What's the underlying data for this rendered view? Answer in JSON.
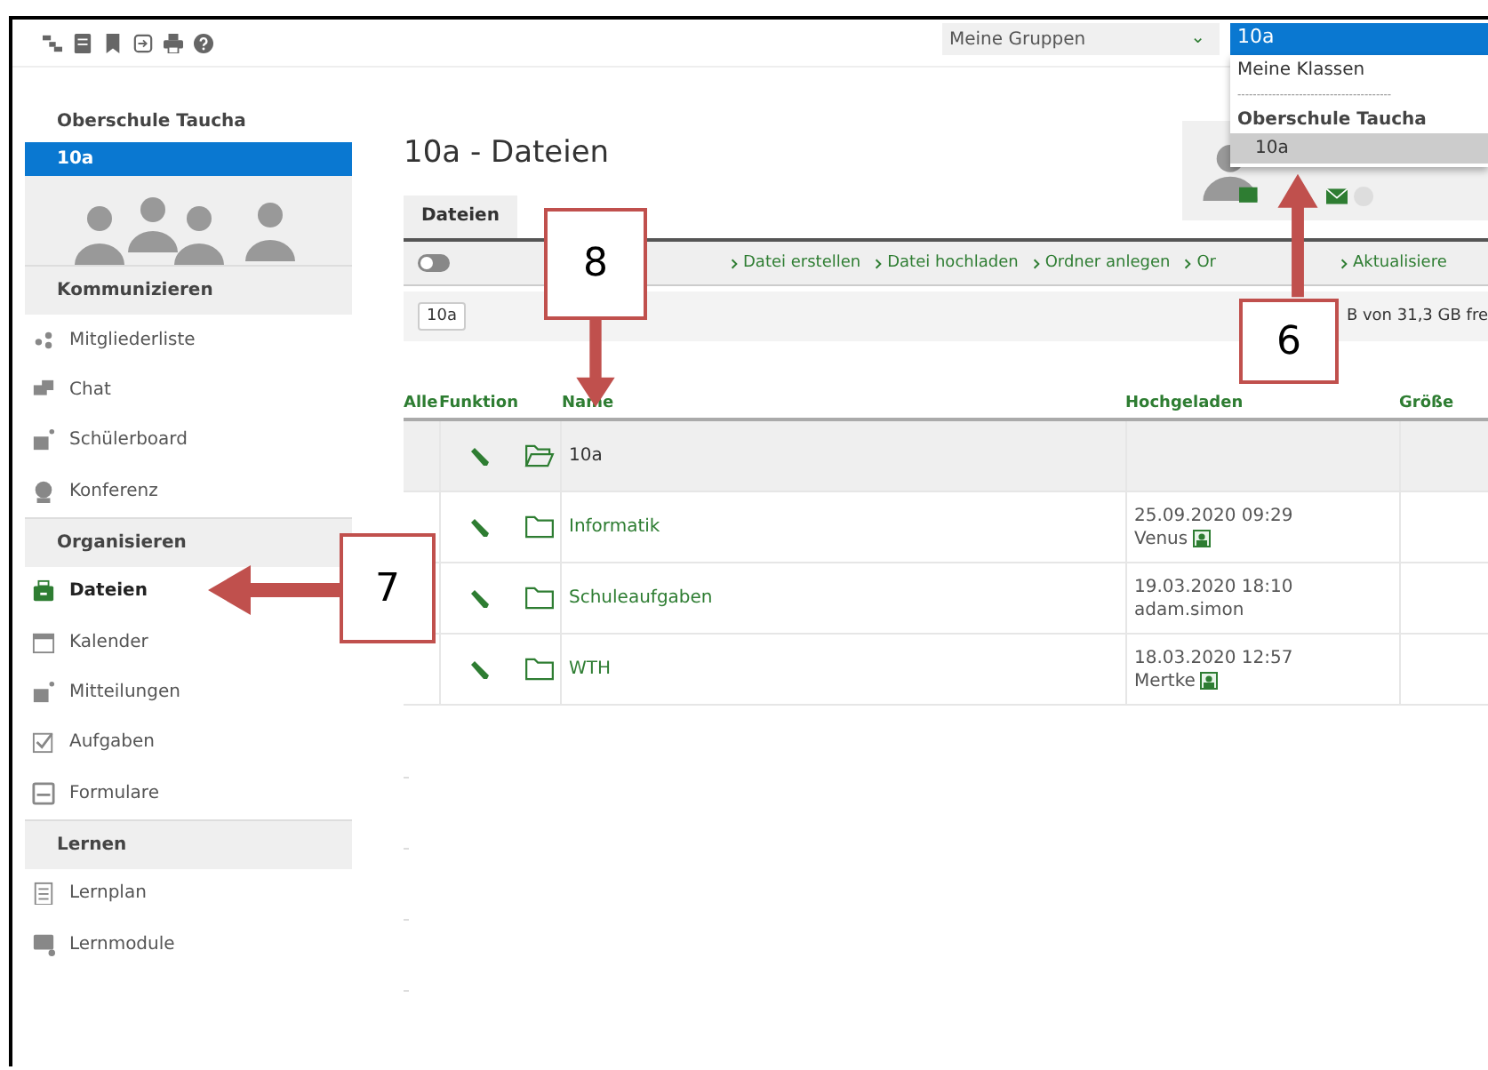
{
  "group_select": {
    "value": "Meine Gruppen",
    "chevron": "⌄"
  },
  "class_select": {
    "value": "10a",
    "options": [
      {
        "label": "Meine Klassen",
        "kind": "option",
        "selected": false
      },
      {
        "label": "----------------------------------------",
        "kind": "separator",
        "selected": false
      },
      {
        "label": "Oberschule Taucha",
        "kind": "group",
        "selected": false
      },
      {
        "label": "10a",
        "kind": "option",
        "selected": true
      }
    ]
  },
  "sidebar": {
    "school": "Oberschule Taucha",
    "group": "10a",
    "sections": [
      {
        "title": "Kommunizieren",
        "items": [
          {
            "label": "Mitgliederliste",
            "selected": false
          },
          {
            "label": "Chat",
            "selected": false
          },
          {
            "label": "Schülerboard",
            "selected": false
          },
          {
            "label": "Konferenz",
            "selected": false
          }
        ]
      },
      {
        "title": "Organisieren",
        "items": [
          {
            "label": "Dateien",
            "selected": true
          },
          {
            "label": "Kalender",
            "selected": false
          },
          {
            "label": "Mitteilungen",
            "selected": false
          },
          {
            "label": "Aufgaben",
            "selected": false
          },
          {
            "label": "Formulare",
            "selected": false
          }
        ]
      },
      {
        "title": "Lernen",
        "items": [
          {
            "label": "Lernplan",
            "selected": false
          },
          {
            "label": "Lernmodule",
            "selected": false
          }
        ]
      }
    ]
  },
  "page_title": "10a - Dateien",
  "tabs": [
    {
      "label": "Dateien",
      "selected": true
    }
  ],
  "toggle": {
    "on": false
  },
  "actions": [
    "Datei erstellen",
    "Datei hochladen",
    "Ordner anlegen",
    "Or",
    "Aktualisiere"
  ],
  "breadcrumb": "10a",
  "storage": "B von 31,3 GB fre",
  "table": {
    "columns": [
      "Alle",
      "Funktion",
      "Name",
      "Hochgeladen",
      "Größe"
    ],
    "rows": [
      {
        "name": "10a",
        "open": true
      },
      {
        "name": "Informatik",
        "open": false,
        "date": "25.09.2020 09:29",
        "user": "Venus",
        "user_icon": true
      },
      {
        "name": "Schuleaufgaben",
        "open": false,
        "date": "19.03.2020 18:10",
        "user": "adam.simon",
        "user_icon": false
      },
      {
        "name": "WTH",
        "open": false,
        "date": "18.03.2020 12:57",
        "user": "Mertke",
        "user_icon": true
      }
    ]
  },
  "callouts": [
    {
      "label": "8",
      "kind": "down"
    },
    {
      "label": "7",
      "kind": "left"
    },
    {
      "label": "6",
      "kind": "up"
    }
  ]
}
